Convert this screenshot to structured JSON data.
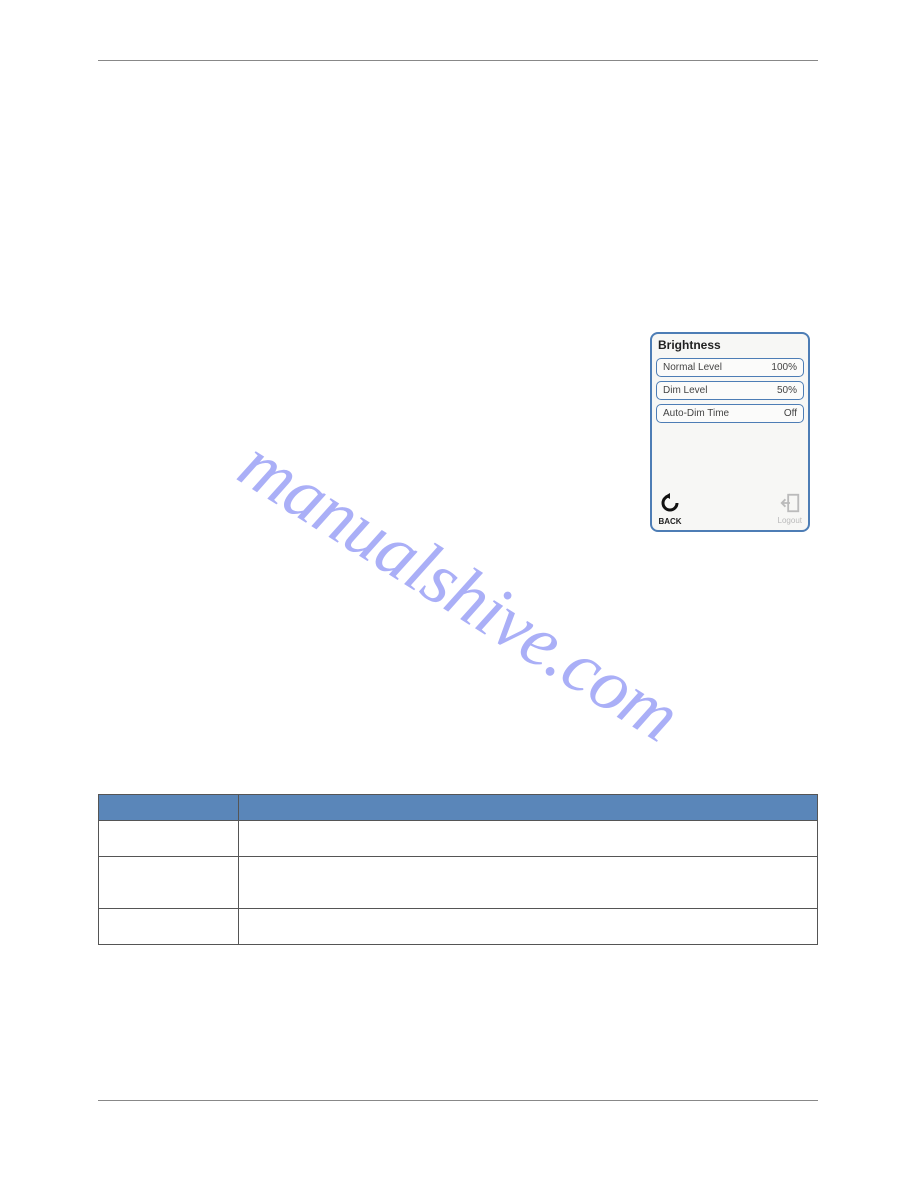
{
  "panel": {
    "title": "Brightness",
    "rows": [
      {
        "label": "Normal Level",
        "value": "100%"
      },
      {
        "label": "Dim Level",
        "value": "50%"
      },
      {
        "label": "Auto-Dim Time",
        "value": "Off"
      }
    ],
    "back_label": "BACK",
    "logout_label": "Logout"
  },
  "table": {
    "headers": [
      "",
      ""
    ],
    "rows": [
      [
        "",
        ""
      ],
      [
        "",
        ""
      ],
      [
        "",
        ""
      ]
    ]
  },
  "watermark": "manualshive.com"
}
